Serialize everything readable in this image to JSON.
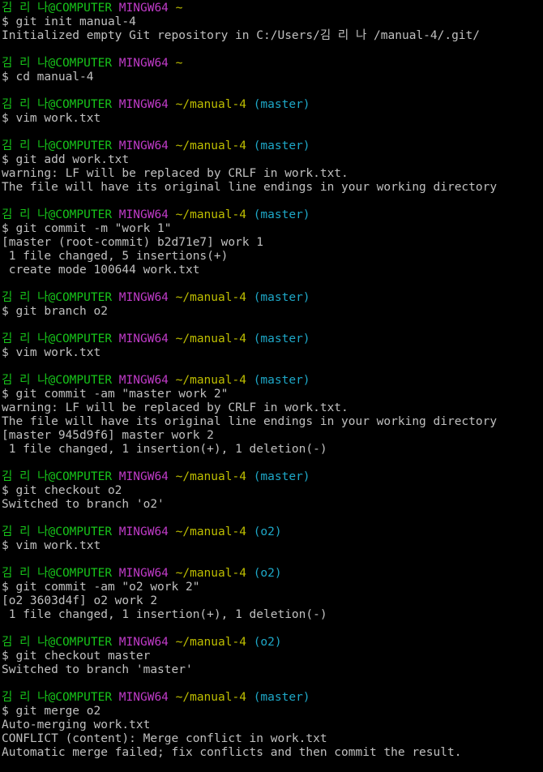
{
  "colors": {
    "background": "#000000",
    "text": "#c0c0c0",
    "user_host": "#17c51a",
    "mingw": "#c03bc8",
    "path": "#bfbf00",
    "branch": "#1ea8c8"
  },
  "prompt": {
    "user": "김 리 나",
    "host": "@COMPUTER",
    "system": "MINGW64"
  },
  "blocks": [
    {
      "path": "~",
      "branch": "",
      "command": "$ git init manual-4",
      "output": [
        "Initialized empty Git repository in C:/Users/김 리 나 /manual-4/.git/"
      ]
    },
    {
      "path": "~",
      "branch": "",
      "command": "$ cd manual-4",
      "output": []
    },
    {
      "path": "~/manual-4",
      "branch": "(master)",
      "command": "$ vim work.txt",
      "output": []
    },
    {
      "path": "~/manual-4",
      "branch": "(master)",
      "command": "$ git add work.txt",
      "output": [
        "warning: LF will be replaced by CRLF in work.txt.",
        "The file will have its original line endings in your working directory"
      ]
    },
    {
      "path": "~/manual-4",
      "branch": "(master)",
      "command": "$ git commit -m \"work 1\"",
      "output": [
        "[master (root-commit) b2d71e7] work 1",
        " 1 file changed, 5 insertions(+)",
        " create mode 100644 work.txt"
      ]
    },
    {
      "path": "~/manual-4",
      "branch": "(master)",
      "command": "$ git branch o2",
      "output": []
    },
    {
      "path": "~/manual-4",
      "branch": "(master)",
      "command": "$ vim work.txt",
      "output": []
    },
    {
      "path": "~/manual-4",
      "branch": "(master)",
      "command": "$ git commit -am \"master work 2\"",
      "output": [
        "warning: LF will be replaced by CRLF in work.txt.",
        "The file will have its original line endings in your working directory",
        "[master 945d9f6] master work 2",
        " 1 file changed, 1 insertion(+), 1 deletion(-)"
      ]
    },
    {
      "path": "~/manual-4",
      "branch": "(master)",
      "command": "$ git checkout o2",
      "output": [
        "Switched to branch 'o2'"
      ]
    },
    {
      "path": "~/manual-4",
      "branch": "(o2)",
      "command": "$ vim work.txt",
      "output": []
    },
    {
      "path": "~/manual-4",
      "branch": "(o2)",
      "command": "$ git commit -am \"o2 work 2\"",
      "output": [
        "[o2 3603d4f] o2 work 2",
        " 1 file changed, 1 insertion(+), 1 deletion(-)"
      ]
    },
    {
      "path": "~/manual-4",
      "branch": "(o2)",
      "command": "$ git checkout master",
      "output": [
        "Switched to branch 'master'"
      ]
    },
    {
      "path": "~/manual-4",
      "branch": "(master)",
      "command": "$ git merge o2",
      "output": [
        "Auto-merging work.txt",
        "CONFLICT (content): Merge conflict in work.txt",
        "Automatic merge failed; fix conflicts and then commit the result."
      ]
    }
  ]
}
